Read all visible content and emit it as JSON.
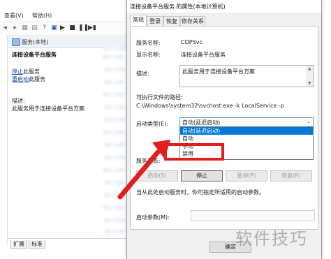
{
  "background": {
    "menu": [
      "查看(V)",
      "帮助(H)"
    ],
    "services_header": "服务(本地)",
    "service_name": "连接设备平台服务",
    "stop_link": "停止",
    "stop_suffix": "此服务",
    "restart_link": "重启动",
    "restart_suffix": "此服务",
    "desc_label": "描述:",
    "desc_text": "此服务用于连接设备平台方案",
    "bottom_tabs": [
      "扩展",
      "标准"
    ]
  },
  "dialog": {
    "title": "连接设备平台服务 的属性(本地计算机)",
    "tabs": [
      "常规",
      "登录",
      "恢复",
      "依存关系"
    ],
    "service_name_label": "服务名称:",
    "service_name_value": "CDPSvc",
    "display_name_label": "显示名称:",
    "display_name_value": "连接设备平台服务",
    "description_label": "描述:",
    "description_value": "此服务用于连接设备平台方案",
    "exe_path_label": "可执行文件的路径:",
    "exe_path_value": "C:\\Windows\\system32\\svchost.exe -k LocalService -p",
    "startup_type_label": "启动类型(E):",
    "startup_type_value": "自动(延迟启动)",
    "startup_options": [
      "自动(延迟启动)",
      "自动",
      "手动",
      "禁用"
    ],
    "service_status_label": "服务状态:",
    "buttons": {
      "start": "启动(S)",
      "stop": "停止",
      "pause": "暂停(P)",
      "resume": "恢复(R)"
    },
    "hint": "当从此处启动服务时，你可指定所适用的启动参数。",
    "start_params_label": "启动参数(M):",
    "ok": "确定"
  },
  "watermark": "软件技巧",
  "colors": {
    "highlight": "#e02020",
    "selection": "#0078d7",
    "arrow": "#e02020"
  }
}
